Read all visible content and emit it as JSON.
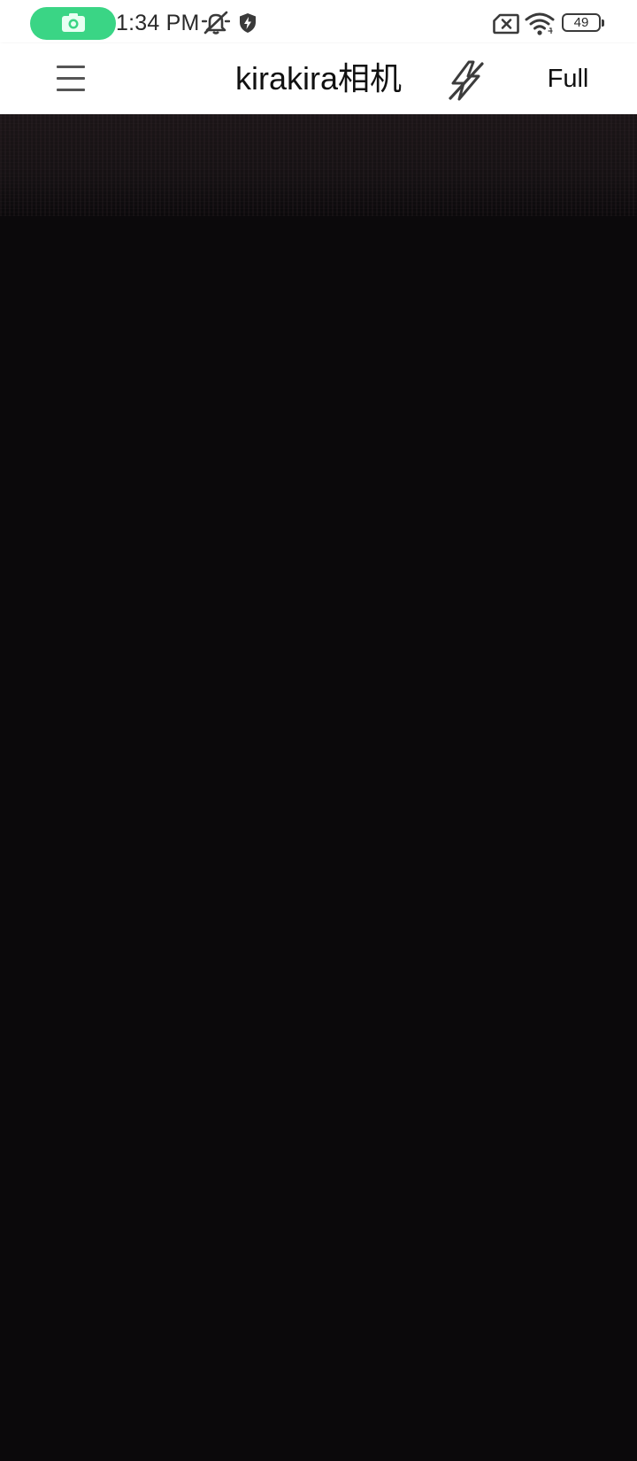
{
  "status_bar": {
    "time": "1:34 PM",
    "battery_level": "49",
    "recording_indicator_icon": "camera-icon",
    "icons": [
      "bell-muted-icon",
      "shield-bolt-icon",
      "sim-none-icon",
      "wifi-icon",
      "battery-icon"
    ],
    "recording_pill_color": "#3ad585"
  },
  "app_bar": {
    "menu_icon": "menu-icon",
    "title": "kirakira相机",
    "flash_icon": "flash-off-icon",
    "full_label": "Full"
  },
  "colors": {
    "app_bar_background": "#ffffff",
    "preview_background": "#0b090b"
  }
}
